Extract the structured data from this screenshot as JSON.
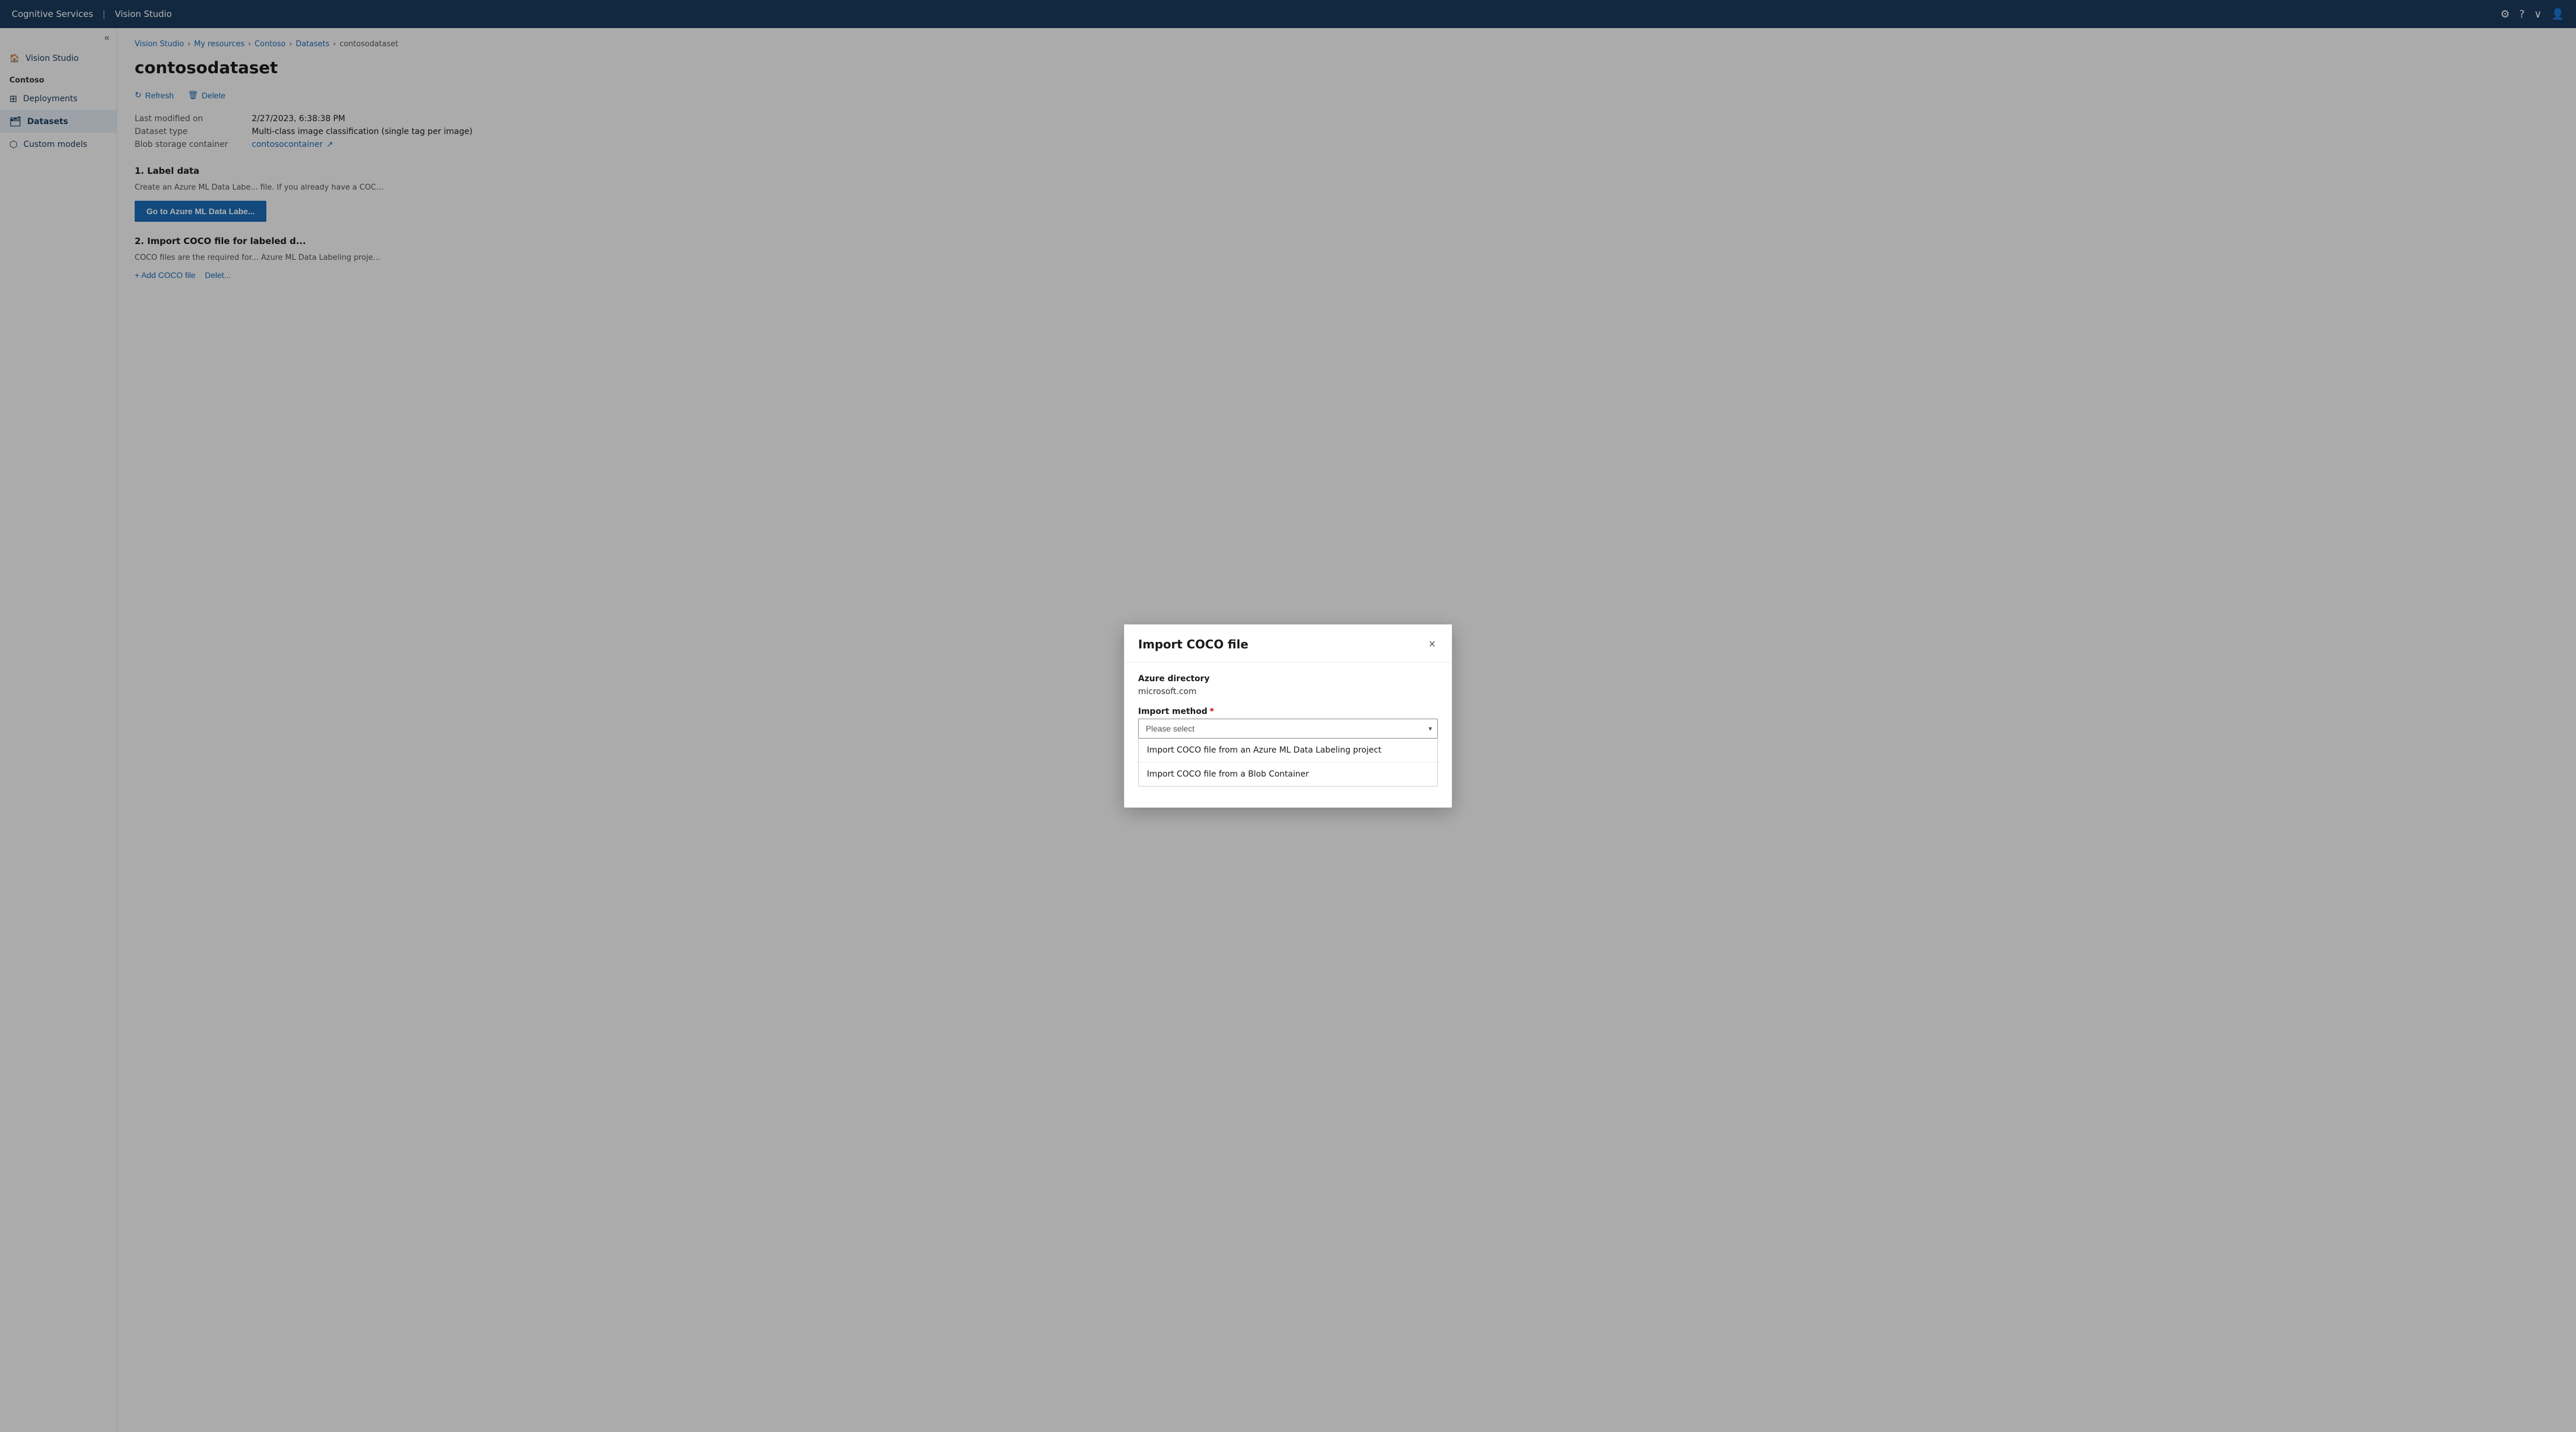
{
  "app": {
    "title": "Cognitive Services",
    "subtitle": "Vision Studio"
  },
  "topnav": {
    "title": "Cognitive Services | Vision Studio",
    "icons": [
      "settings-icon",
      "help-icon",
      "chevron-down-icon",
      "account-icon"
    ]
  },
  "sidebar": {
    "toggle_label": "«",
    "home_label": "Vision Studio",
    "section_label": "Contoso",
    "items": [
      {
        "label": "Deployments",
        "icon": "⊞"
      },
      {
        "label": "Datasets",
        "icon": "🗂",
        "active": true
      },
      {
        "label": "Custom models",
        "icon": "⬡"
      }
    ]
  },
  "breadcrumb": {
    "items": [
      {
        "label": "Vision Studio"
      },
      {
        "label": "My resources"
      },
      {
        "label": "Contoso"
      },
      {
        "label": "Datasets"
      },
      {
        "label": "contosodataset"
      }
    ]
  },
  "page": {
    "title": "contosodataset",
    "actions": {
      "refresh": "Refresh",
      "delete": "Delete"
    },
    "metadata": {
      "last_modified_label": "Last modified on",
      "last_modified_value": "2/27/2023, 6:38:38 PM",
      "dataset_type_label": "Dataset type",
      "dataset_type_value": "Multi-class image classification (single tag per image)",
      "blob_storage_label": "Blob storage container",
      "blob_storage_link": "contosocontainer"
    },
    "sections": {
      "label_data": {
        "number": "1.",
        "title": "Label data",
        "description": "Create an Azure ML Data Labe... file. If you already have a COC...",
        "button": "Go to Azure ML Data Labe..."
      },
      "import_coco": {
        "number": "2.",
        "title": "Import COCO file for labeled d...",
        "description": "COCO files are the required for... Azure ML Data Labeling proje...",
        "add_label": "+ Add COCO file",
        "delete_label": "Delet..."
      }
    }
  },
  "modal": {
    "title": "Import COCO file",
    "close_label": "×",
    "azure_directory_label": "Azure directory",
    "azure_directory_value": "microsoft.com",
    "import_method_label": "Import method",
    "import_method_required": true,
    "select_placeholder": "Please select",
    "options": [
      {
        "label": "Import COCO file from an Azure ML Data Labeling project"
      },
      {
        "label": "Import COCO file from a Blob Container"
      }
    ]
  }
}
